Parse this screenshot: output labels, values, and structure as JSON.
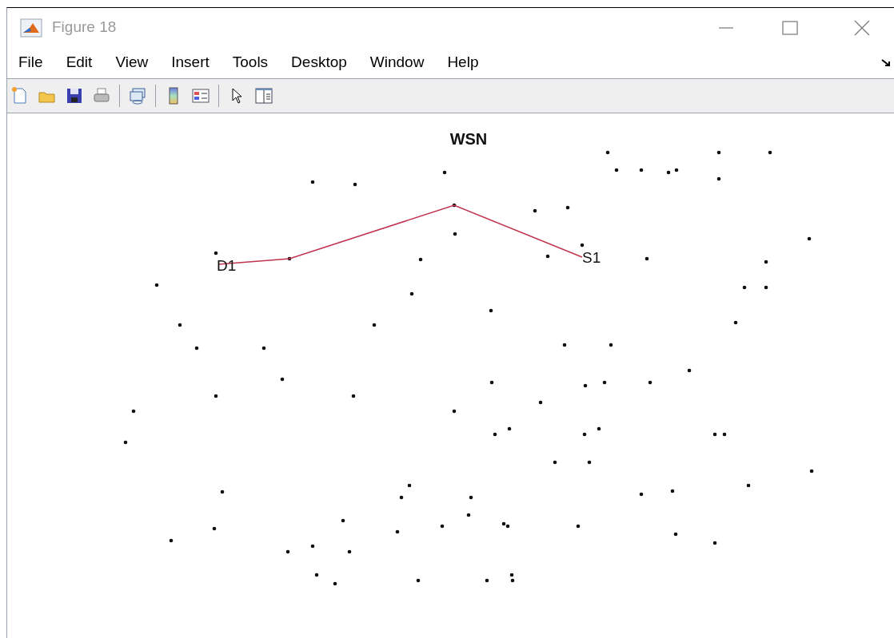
{
  "window": {
    "title": "Figure 18",
    "active": false
  },
  "menu": [
    "File",
    "Edit",
    "View",
    "Insert",
    "Tools",
    "Desktop",
    "Window",
    "Help"
  ],
  "plot": {
    "title": "WSN",
    "route_labels": [
      {
        "text": "D1"
      },
      {
        "text": "S1"
      }
    ]
  }
}
